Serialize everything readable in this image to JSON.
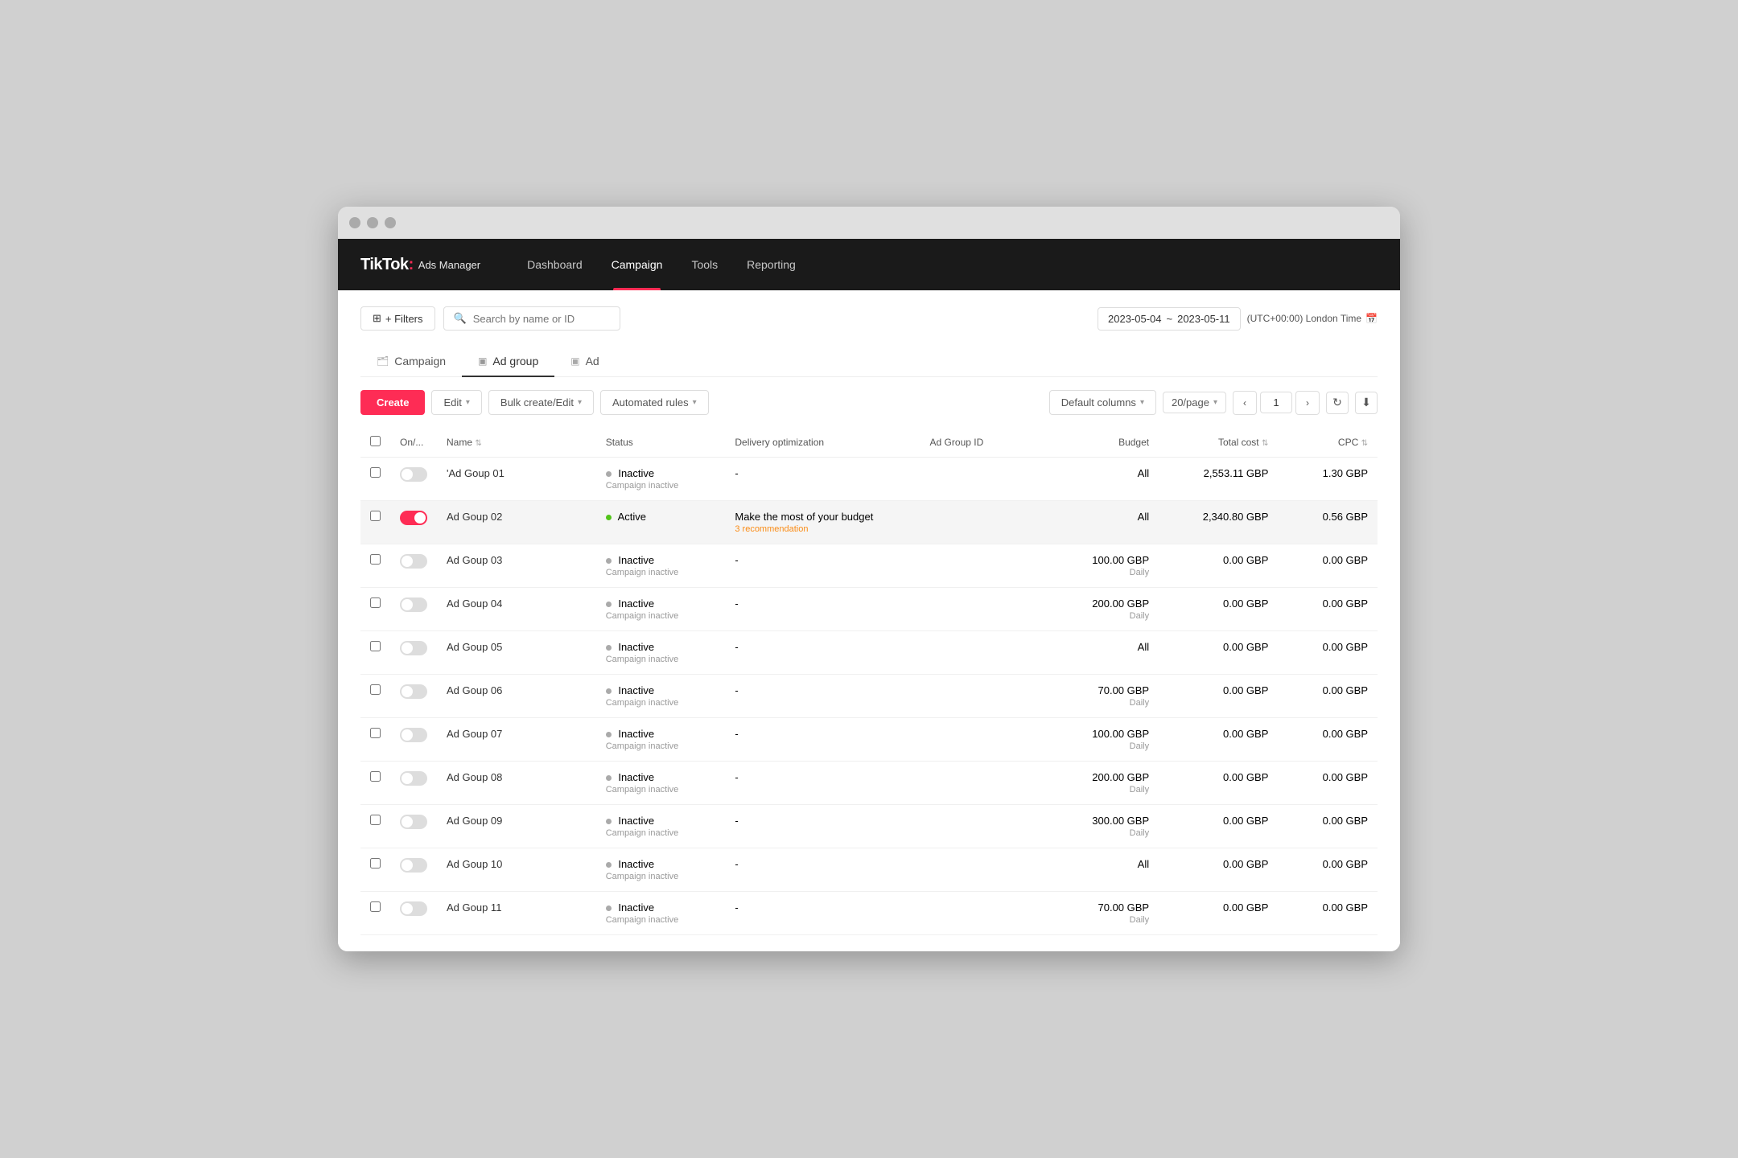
{
  "window": {
    "title": "TikTok Ads Manager"
  },
  "nav": {
    "logo": "TikTok",
    "logo_colon": ":",
    "logo_sub": "Ads Manager",
    "links": [
      {
        "label": "Dashboard",
        "active": false
      },
      {
        "label": "Campaign",
        "active": true
      },
      {
        "label": "Tools",
        "active": false
      },
      {
        "label": "Reporting",
        "active": false
      }
    ]
  },
  "topbar": {
    "filters_label": "+ Filters",
    "search_placeholder": "Search by name or ID",
    "date_start": "2023-05-04",
    "date_tilde": "~",
    "date_end": "2023-05-11",
    "timezone": "(UTC+00:00) London Time",
    "calendar_icon": "📅"
  },
  "tabs": [
    {
      "label": "Campaign",
      "icon": "🗂",
      "active": false
    },
    {
      "label": "Ad group",
      "icon": "▣",
      "active": true
    },
    {
      "label": "Ad",
      "icon": "▣",
      "active": false
    }
  ],
  "toolbar": {
    "create_label": "Create",
    "edit_label": "Edit",
    "bulk_label": "Bulk create/Edit",
    "rules_label": "Automated rules",
    "columns_label": "Default columns",
    "per_page_label": "20/page",
    "page_num": "1",
    "prev_icon": "‹",
    "next_icon": "›"
  },
  "table": {
    "headers": [
      {
        "label": "",
        "key": "checkbox"
      },
      {
        "label": "On/...",
        "key": "toggle"
      },
      {
        "label": "Name",
        "key": "name",
        "sortable": true
      },
      {
        "label": "Status",
        "key": "status"
      },
      {
        "label": "Delivery optimization",
        "key": "delivery"
      },
      {
        "label": "Ad Group ID",
        "key": "id"
      },
      {
        "label": "Budget",
        "key": "budget"
      },
      {
        "label": "Total cost",
        "key": "total_cost",
        "sortable": true
      },
      {
        "label": "CPC",
        "key": "cpc",
        "sortable": true
      }
    ],
    "rows": [
      {
        "name": "'Ad Goup 01",
        "toggle": false,
        "status": "Inactive",
        "status_sub": "Campaign inactive",
        "delivery": "-",
        "delivery_sub": "",
        "id": "",
        "budget": "All",
        "budget_sub": "",
        "total_cost": "2,553.11 GBP",
        "cpc": "1.30 GBP",
        "highlighted": false
      },
      {
        "name": "Ad Goup 02",
        "toggle": true,
        "status": "Active",
        "status_sub": "",
        "delivery": "Make the most of your budget",
        "delivery_sub": "3 recommendation",
        "id": "",
        "budget": "All",
        "budget_sub": "",
        "total_cost": "2,340.80 GBP",
        "cpc": "0.56 GBP",
        "highlighted": true
      },
      {
        "name": "Ad Goup 03",
        "toggle": false,
        "status": "Inactive",
        "status_sub": "Campaign inactive",
        "delivery": "-",
        "delivery_sub": "",
        "id": "",
        "budget": "100.00 GBP",
        "budget_sub": "Daily",
        "total_cost": "0.00 GBP",
        "cpc": "0.00 GBP",
        "highlighted": false
      },
      {
        "name": "Ad Goup 04",
        "toggle": false,
        "status": "Inactive",
        "status_sub": "Campaign inactive",
        "delivery": "-",
        "delivery_sub": "",
        "id": "",
        "budget": "200.00 GBP",
        "budget_sub": "Daily",
        "total_cost": "0.00 GBP",
        "cpc": "0.00 GBP",
        "highlighted": false
      },
      {
        "name": "Ad Goup 05",
        "toggle": false,
        "status": "Inactive",
        "status_sub": "Campaign inactive",
        "delivery": "-",
        "delivery_sub": "",
        "id": "",
        "budget": "All",
        "budget_sub": "",
        "total_cost": "0.00 GBP",
        "cpc": "0.00 GBP",
        "highlighted": false
      },
      {
        "name": "Ad Goup 06",
        "toggle": false,
        "status": "Inactive",
        "status_sub": "Campaign inactive",
        "delivery": "-",
        "delivery_sub": "",
        "id": "",
        "budget": "70.00 GBP",
        "budget_sub": "Daily",
        "total_cost": "0.00 GBP",
        "cpc": "0.00 GBP",
        "highlighted": false
      },
      {
        "name": "Ad Goup 07",
        "toggle": false,
        "status": "Inactive",
        "status_sub": "Campaign inactive",
        "delivery": "-",
        "delivery_sub": "",
        "id": "",
        "budget": "100.00 GBP",
        "budget_sub": "Daily",
        "total_cost": "0.00 GBP",
        "cpc": "0.00 GBP",
        "highlighted": false
      },
      {
        "name": "Ad Goup 08",
        "toggle": false,
        "status": "Inactive",
        "status_sub": "Campaign inactive",
        "delivery": "-",
        "delivery_sub": "",
        "id": "",
        "budget": "200.00 GBP",
        "budget_sub": "Daily",
        "total_cost": "0.00 GBP",
        "cpc": "0.00 GBP",
        "highlighted": false
      },
      {
        "name": "Ad Goup 09",
        "toggle": false,
        "status": "Inactive",
        "status_sub": "Campaign inactive",
        "delivery": "-",
        "delivery_sub": "",
        "id": "",
        "budget": "300.00 GBP",
        "budget_sub": "Daily",
        "total_cost": "0.00 GBP",
        "cpc": "0.00 GBP",
        "highlighted": false
      },
      {
        "name": "Ad Goup 10",
        "toggle": false,
        "status": "Inactive",
        "status_sub": "Campaign inactive",
        "delivery": "-",
        "delivery_sub": "",
        "id": "",
        "budget": "All",
        "budget_sub": "",
        "total_cost": "0.00 GBP",
        "cpc": "0.00 GBP",
        "highlighted": false
      },
      {
        "name": "Ad Goup 11",
        "toggle": false,
        "status": "Inactive",
        "status_sub": "Campaign inactive",
        "delivery": "-",
        "delivery_sub": "",
        "id": "",
        "budget": "70.00 GBP",
        "budget_sub": "Daily",
        "total_cost": "0.00 GBP",
        "cpc": "0.00 GBP",
        "highlighted": false
      }
    ]
  }
}
